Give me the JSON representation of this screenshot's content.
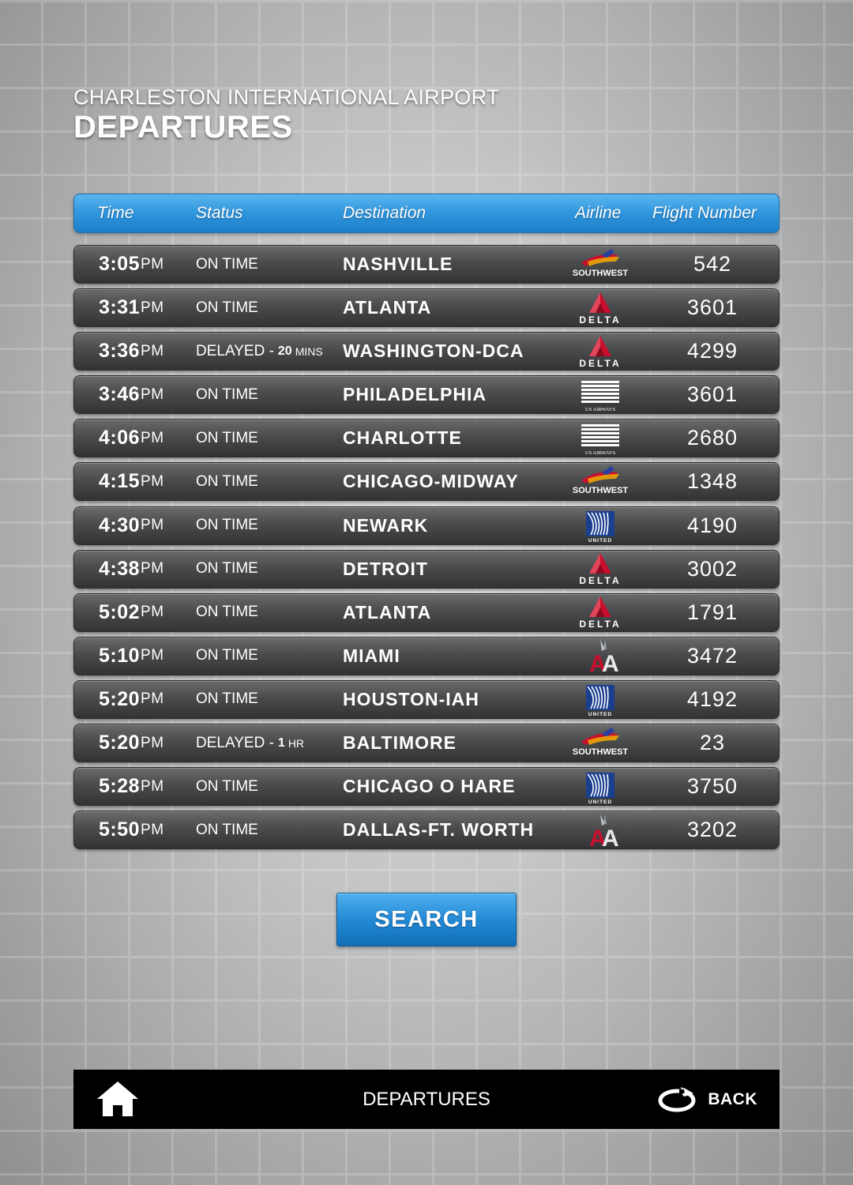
{
  "header": {
    "airport": "CHARLESTON INTERNATIONAL AIRPORT",
    "title": "DEPARTURES"
  },
  "columns": {
    "time": "Time",
    "status": "Status",
    "destination": "Destination",
    "airline": "Airline",
    "flight": "Flight Number"
  },
  "flights": [
    {
      "time": "3:05",
      "ampm": "PM",
      "status": "ON TIME",
      "delay_amount": "",
      "delay_unit": "",
      "destination": "NASHVILLE",
      "airline": "southwest",
      "flight": "542"
    },
    {
      "time": "3:31",
      "ampm": "PM",
      "status": "ON TIME",
      "delay_amount": "",
      "delay_unit": "",
      "destination": "ATLANTA",
      "airline": "delta",
      "flight": "3601"
    },
    {
      "time": "3:36",
      "ampm": "PM",
      "status": "DELAYED -",
      "delay_amount": "20",
      "delay_unit": "MINS",
      "destination": "WASHINGTON-DCA",
      "airline": "delta",
      "flight": "4299"
    },
    {
      "time": "3:46",
      "ampm": "PM",
      "status": "ON TIME",
      "delay_amount": "",
      "delay_unit": "",
      "destination": "PHILADELPHIA",
      "airline": "usairways",
      "flight": "3601"
    },
    {
      "time": "4:06",
      "ampm": "PM",
      "status": "ON TIME",
      "delay_amount": "",
      "delay_unit": "",
      "destination": "CHARLOTTE",
      "airline": "usairways",
      "flight": "2680"
    },
    {
      "time": "4:15",
      "ampm": "PM",
      "status": "ON TIME",
      "delay_amount": "",
      "delay_unit": "",
      "destination": "CHICAGO-MIDWAY",
      "airline": "southwest",
      "flight": "1348"
    },
    {
      "time": "4:30",
      "ampm": "PM",
      "status": "ON TIME",
      "delay_amount": "",
      "delay_unit": "",
      "destination": "NEWARK",
      "airline": "united",
      "flight": "4190"
    },
    {
      "time": "4:38",
      "ampm": "PM",
      "status": "ON TIME",
      "delay_amount": "",
      "delay_unit": "",
      "destination": "DETROIT",
      "airline": "delta",
      "flight": "3002"
    },
    {
      "time": "5:02",
      "ampm": "PM",
      "status": "ON TIME",
      "delay_amount": "",
      "delay_unit": "",
      "destination": "ATLANTA",
      "airline": "delta",
      "flight": "1791"
    },
    {
      "time": "5:10",
      "ampm": "PM",
      "status": "ON TIME",
      "delay_amount": "",
      "delay_unit": "",
      "destination": "MIAMI",
      "airline": "american",
      "flight": "3472"
    },
    {
      "time": "5:20",
      "ampm": "PM",
      "status": "ON TIME",
      "delay_amount": "",
      "delay_unit": "",
      "destination": "HOUSTON-IAH",
      "airline": "united",
      "flight": "4192"
    },
    {
      "time": "5:20",
      "ampm": "PM",
      "status": "DELAYED -",
      "delay_amount": "1",
      "delay_unit": "HR",
      "destination": "BALTIMORE",
      "airline": "southwest",
      "flight": "23"
    },
    {
      "time": "5:28",
      "ampm": "PM",
      "status": "ON TIME",
      "delay_amount": "",
      "delay_unit": "",
      "destination": "CHICAGO O HARE",
      "airline": "united",
      "flight": "3750"
    },
    {
      "time": "5:50",
      "ampm": "PM",
      "status": "ON TIME",
      "delay_amount": "",
      "delay_unit": "",
      "destination": "DALLAS-FT. WORTH",
      "airline": "american",
      "flight": "3202"
    }
  ],
  "logos": {
    "southwest": "SOUTHWEST",
    "delta": "DELTA",
    "usairways": "US AIRWAYS",
    "united": "UNITED"
  },
  "search_label": "SEARCH",
  "footer": {
    "title": "DEPARTURES",
    "back_label": "BACK",
    "home_icon": "home-icon",
    "back_icon": "back-arrow-icon"
  },
  "colors": {
    "header_blue": "#2f95dd",
    "row_dark": "#4a4b4d",
    "delta_red": "#c8102e",
    "united_blue": "#1b3f8f",
    "southwest_blue": "#2a3f9e"
  }
}
